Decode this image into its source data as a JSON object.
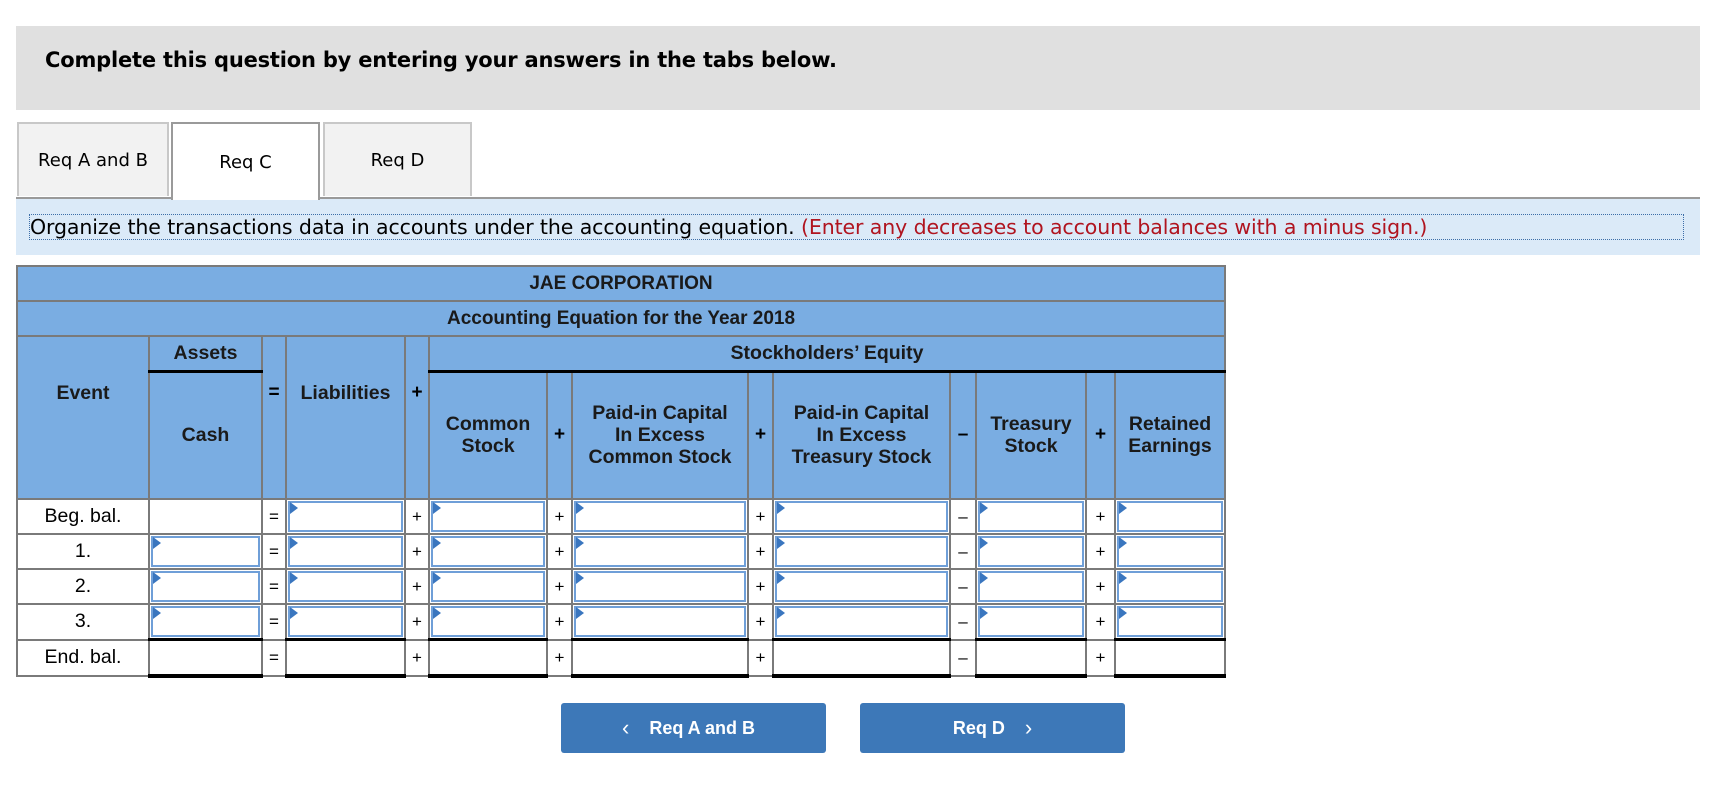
{
  "banner": {
    "text": "Complete this question by entering your answers in the tabs below."
  },
  "tabs": [
    {
      "label": "Req A and B",
      "active": false
    },
    {
      "label": "Req C",
      "active": true
    },
    {
      "label": "Req D",
      "active": false
    }
  ],
  "instructions": {
    "text": "Organize the transactions data in accounts under the accounting equation.",
    "note": "(Enter any decreases to account balances with a minus sign.)"
  },
  "table": {
    "company": "JAE CORPORATION",
    "subtitle": "Accounting Equation for the Year 2018",
    "group_assets": "Assets",
    "group_equity": "Stockholders’ Equity",
    "columns": {
      "event": "Event",
      "cash": "Cash",
      "liabilities": "Liabilities",
      "common_stock_1": "Common",
      "common_stock_2": "Stock",
      "pic_cs_1": "Paid-in Capital",
      "pic_cs_2": "In Excess",
      "pic_cs_3": "Common Stock",
      "pic_ts_1": "Paid-in Capital",
      "pic_ts_2": "In Excess",
      "pic_ts_3": "Treasury Stock",
      "treasury_1": "Treasury",
      "treasury_2": "Stock",
      "re_1": "Retained",
      "re_2": "Earnings"
    },
    "operators": {
      "eq": "=",
      "plus": "+",
      "minus": "–"
    },
    "rows": [
      {
        "event": "Beg. bal.",
        "cash": "",
        "liabilities": "",
        "common_stock": "",
        "pic_cs": "",
        "pic_ts": "",
        "treasury": "",
        "retained_earnings": ""
      },
      {
        "event": "1.",
        "cash": "",
        "liabilities": "",
        "common_stock": "",
        "pic_cs": "",
        "pic_ts": "",
        "treasury": "",
        "retained_earnings": ""
      },
      {
        "event": "2.",
        "cash": "",
        "liabilities": "",
        "common_stock": "",
        "pic_cs": "",
        "pic_ts": "",
        "treasury": "",
        "retained_earnings": ""
      },
      {
        "event": "3.",
        "cash": "",
        "liabilities": "",
        "common_stock": "",
        "pic_cs": "",
        "pic_ts": "",
        "treasury": "",
        "retained_earnings": ""
      },
      {
        "event": "End. bal.",
        "cash": "",
        "liabilities": "",
        "common_stock": "",
        "pic_cs": "",
        "pic_ts": "",
        "treasury": "",
        "retained_earnings": ""
      }
    ]
  },
  "nav": {
    "prev_label": "Req A and B",
    "next_label": "Req D",
    "prev_icon": "chevron-left-icon",
    "next_icon": "chevron-right-icon"
  },
  "colors": {
    "header_blue": "#7aade2",
    "button_blue": "#3d78b8",
    "instruction_bg": "#dbeaf8",
    "note_red": "#b0141f",
    "banner_gray": "#e0e0e0"
  }
}
